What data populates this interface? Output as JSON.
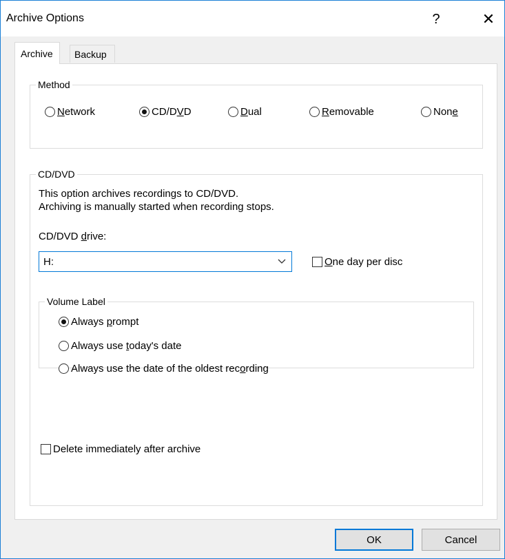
{
  "window": {
    "title": "Archive Options",
    "help_glyph": "?",
    "close_glyph": "✕",
    "accent_color": "#1a7fd6"
  },
  "tabs": [
    {
      "label": "Archive",
      "active": true
    },
    {
      "label": "Backup",
      "active": false
    }
  ],
  "method": {
    "legend": "Method",
    "options": [
      {
        "pre": "",
        "u": "N",
        "post": "etwork",
        "checked": false
      },
      {
        "pre": "CD/D",
        "u": "V",
        "post": "D",
        "checked": true
      },
      {
        "pre": "",
        "u": "D",
        "post": "ual",
        "checked": false
      },
      {
        "pre": "",
        "u": "R",
        "post": "emovable",
        "checked": false
      },
      {
        "pre": "Non",
        "u": "e",
        "post": "",
        "checked": false
      }
    ]
  },
  "cddvd": {
    "legend": "CD/DVD",
    "description_line1": "This option archives recordings to CD/DVD.",
    "description_line2": "Archiving is manually started when recording stops.",
    "drive_label_pre": "CD/DVD ",
    "drive_label_u": "d",
    "drive_label_post": "rive:",
    "drive_value": "H:",
    "one_day": {
      "pre": "",
      "u": "O",
      "post": "ne day per disc",
      "checked": false
    }
  },
  "volume_label": {
    "legend": "Volume Label",
    "options": [
      {
        "pre": "Always ",
        "u": "p",
        "post": "rompt",
        "checked": true
      },
      {
        "pre": "Always use ",
        "u": "t",
        "post": "oday's date",
        "checked": false
      },
      {
        "pre": "Always use the date of the oldest rec",
        "u": "o",
        "post": "rding",
        "checked": false
      }
    ]
  },
  "delete_after": {
    "label": "Delete immediately after archive",
    "checked": false
  },
  "buttons": {
    "ok": "OK",
    "cancel": "Cancel"
  }
}
